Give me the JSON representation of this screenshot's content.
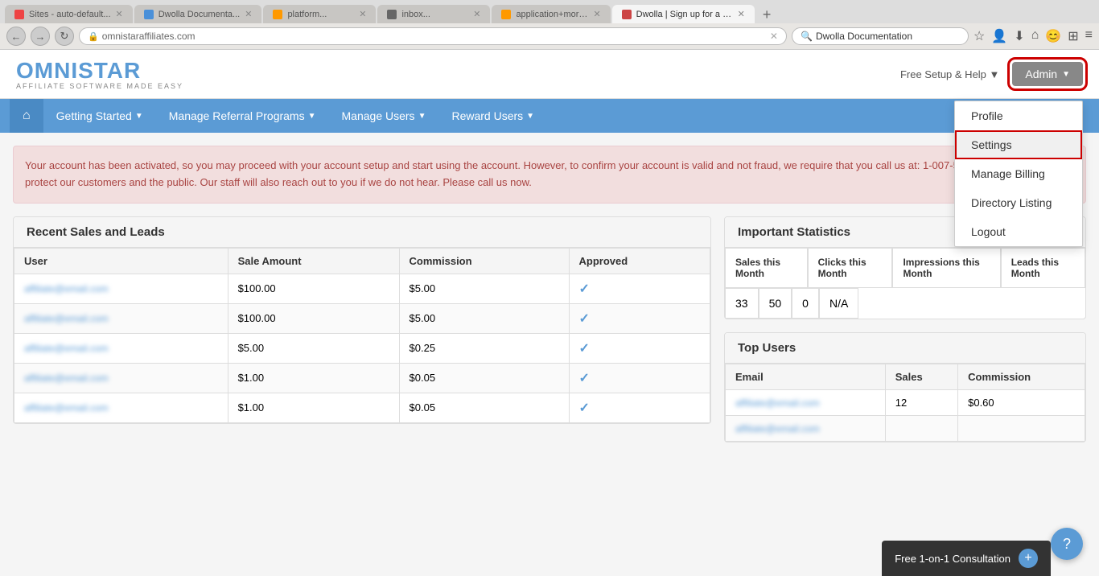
{
  "browser": {
    "tabs": [
      {
        "label": "Sites - auto-default+s...",
        "active": false,
        "color": "#e44"
      },
      {
        "label": "Dwolla Documentatio...",
        "active": false,
        "color": "#4a90d9"
      },
      {
        "label": "platform...",
        "active": false,
        "color": "#f90"
      },
      {
        "label": "inbox...",
        "active": false,
        "color": "#666"
      },
      {
        "label": "application+more...",
        "active": false,
        "color": "#f90"
      },
      {
        "label": "Dwolla | Sign up for a fre...",
        "active": true,
        "color": "#c44"
      }
    ],
    "address": "omnistaraffiliates.com",
    "search_placeholder": "Dwolla Documentation"
  },
  "header": {
    "logo_omni": "OMNI",
    "logo_star": "STAR",
    "logo_sub": "AFFILIATE SOFTWARE MADE EASY",
    "free_setup": "Free Setup & Help ▼",
    "admin_label": "Admin"
  },
  "nav": {
    "home_icon": "⌂",
    "items": [
      {
        "label": "Getting Started",
        "caret": "▼"
      },
      {
        "label": "Manage Referral Programs",
        "caret": "▼"
      },
      {
        "label": "Manage Users",
        "caret": "▼"
      },
      {
        "label": "Reward Users",
        "caret": "▼"
      }
    ]
  },
  "admin_dropdown": {
    "items": [
      {
        "label": "Profile",
        "highlighted": false
      },
      {
        "label": "Settings",
        "highlighted": true
      },
      {
        "label": "Manage Billing",
        "highlighted": false
      },
      {
        "label": "Directory Listing",
        "highlighted": false
      },
      {
        "label": "Logout",
        "highlighted": false
      }
    ]
  },
  "alert": {
    "text": "Your account has been activated, so you may proceed with your account setup and start using the account. However, to confirm your account is valid and not fraud, we require that you call us at: 1-007-555-1188. We do this to protect our customers and the public. Our staff will also reach out to you if we do not hear. Please call us now."
  },
  "recent_sales": {
    "title": "Recent Sales and Leads",
    "columns": [
      "User",
      "Sale Amount",
      "Commission",
      "Approved"
    ],
    "rows": [
      {
        "user": "affiliate@email.com",
        "sale": "$100.00",
        "commission": "$5.00",
        "approved": true
      },
      {
        "user": "affiliate@email.com",
        "sale": "$100.00",
        "commission": "$5.00",
        "approved": true
      },
      {
        "user": "affiliate@email.com",
        "sale": "$5.00",
        "commission": "$0.25",
        "approved": true
      },
      {
        "user": "affiliate@email.com",
        "sale": "$1.00",
        "commission": "$0.05",
        "approved": true
      },
      {
        "user": "affiliate@email.com",
        "sale": "$1.00",
        "commission": "$0.05",
        "approved": true
      }
    ]
  },
  "important_stats": {
    "title": "Important Statistics",
    "headers": [
      "Sales this Month",
      "Clicks this Month",
      "Impressions this Month",
      "Leads this Month"
    ],
    "values": [
      "33",
      "50",
      "0",
      "N/A"
    ]
  },
  "top_users": {
    "title": "Top Users",
    "columns": [
      "Email",
      "Sales",
      "Commission"
    ],
    "rows": [
      {
        "email": "affiliate@email.com",
        "sales": "12",
        "commission": "$0.60"
      },
      {
        "email": "affiliate@email.com",
        "sales": "",
        "commission": ""
      }
    ]
  },
  "help_button": "?",
  "consultation": {
    "label": "Free 1-on-1 Consultation",
    "plus": "+"
  }
}
